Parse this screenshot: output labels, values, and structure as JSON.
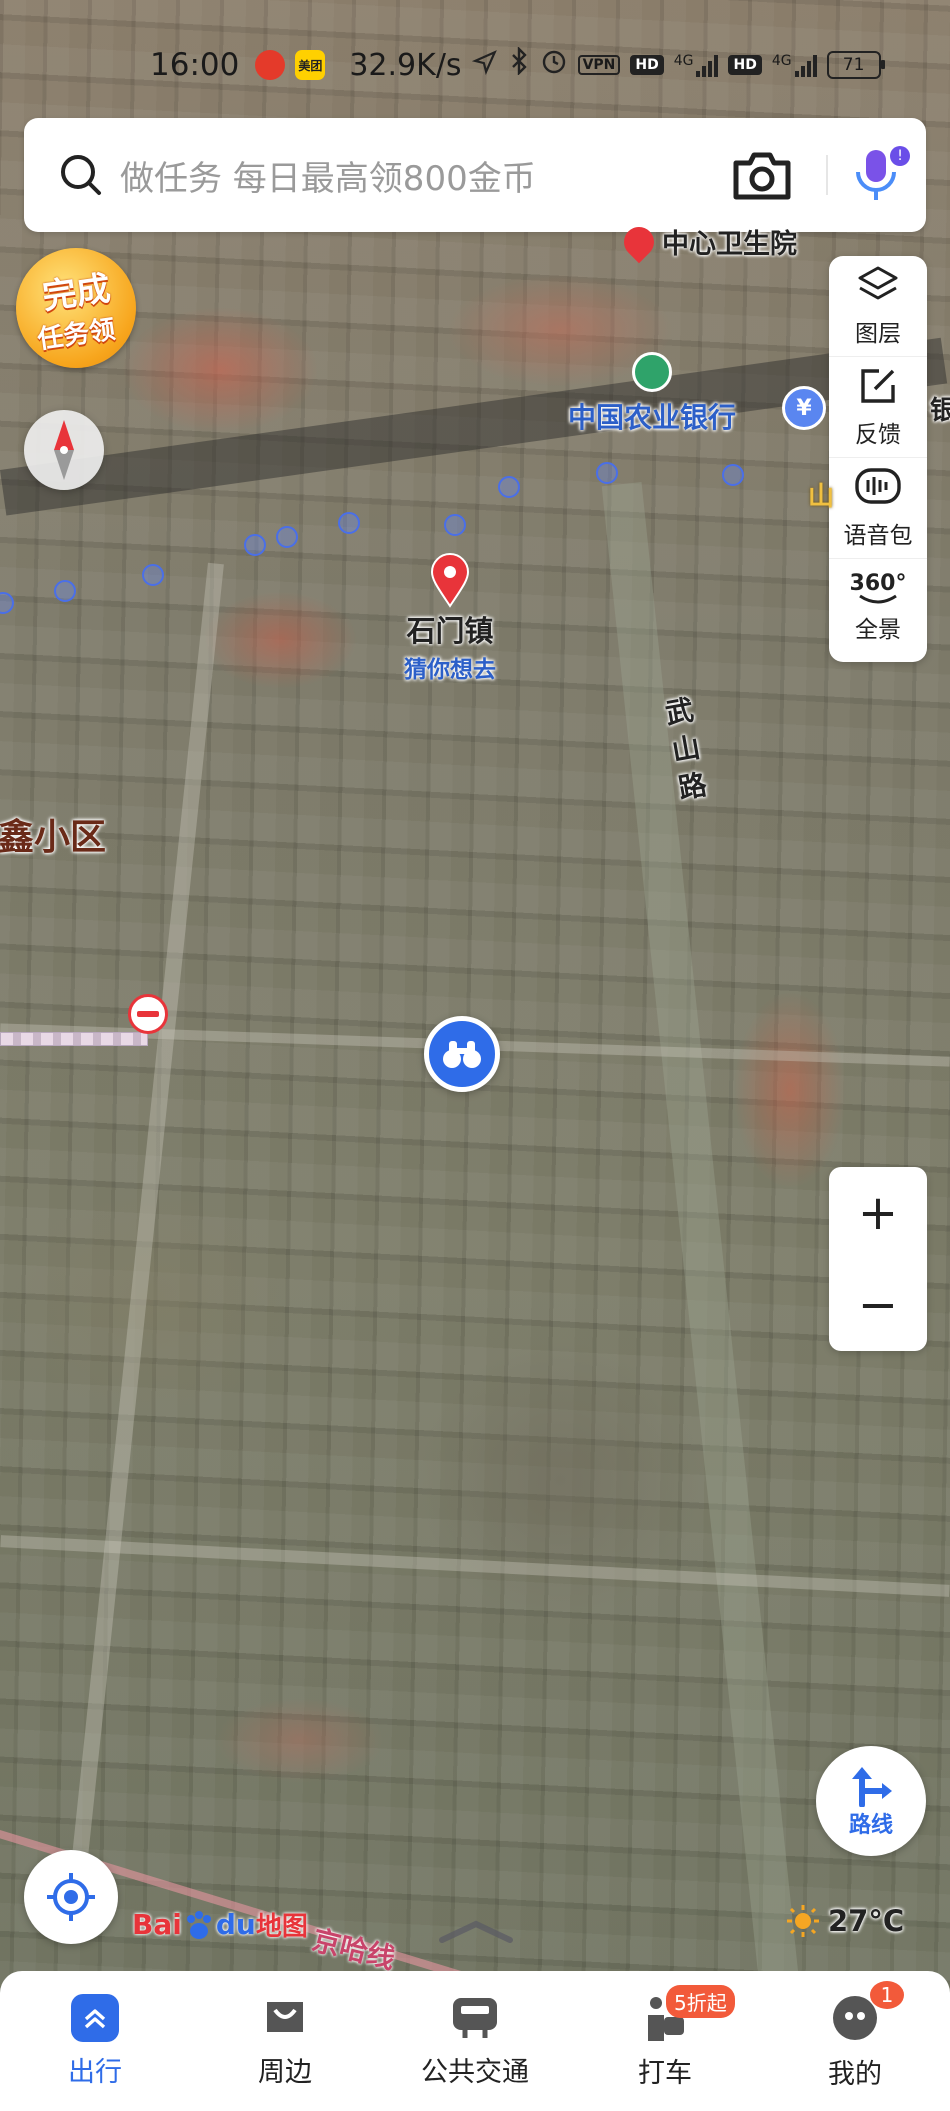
{
  "status_bar": {
    "time": "16:00",
    "speed": "32.9K/s",
    "vpn": "VPN",
    "hd1": "HD",
    "net1": "4G",
    "hd2": "HD",
    "net2": "4G",
    "battery": "71",
    "app_icons": [
      "pinduoduo-icon",
      "meituan-icon"
    ],
    "meituan_label": "美团"
  },
  "search": {
    "placeholder": "做任务 每日最高领800金币"
  },
  "task_badge": {
    "line1": "完成",
    "line2": "任务领"
  },
  "side_panel": {
    "items": [
      {
        "label": "图层",
        "icon": "layers-icon"
      },
      {
        "label": "反馈",
        "icon": "feedback-icon"
      },
      {
        "label": "语音包",
        "icon": "voice-pack-icon"
      },
      {
        "label": "全景",
        "icon": "panorama-360-icon"
      }
    ],
    "pano_text": "360°"
  },
  "map_labels": {
    "clinic": "中心卫生院",
    "bank": "中国农业银行",
    "bank_partial": "银",
    "road_wushan": "武山路",
    "district": "鑫小区",
    "place_name": "石门镇",
    "place_sub": "猜你想去",
    "rail": "京哈线",
    "partial_shan": "山"
  },
  "route_button": {
    "label": "路线"
  },
  "weather": {
    "temp": "27°C"
  },
  "brand": {
    "text_bai": "Bai",
    "text_du": "du",
    "text_map": "地图"
  },
  "tabs": [
    {
      "label": "出行",
      "active": true
    },
    {
      "label": "周边",
      "active": false
    },
    {
      "label": "公共交通",
      "active": false
    },
    {
      "label": "打车",
      "active": false,
      "badge": "5折起"
    },
    {
      "label": "我的",
      "active": false,
      "badge": "1"
    }
  ],
  "colors": {
    "accent": "#2f6ce8",
    "badge": "#f25a3a",
    "pin": "#e8343a"
  }
}
